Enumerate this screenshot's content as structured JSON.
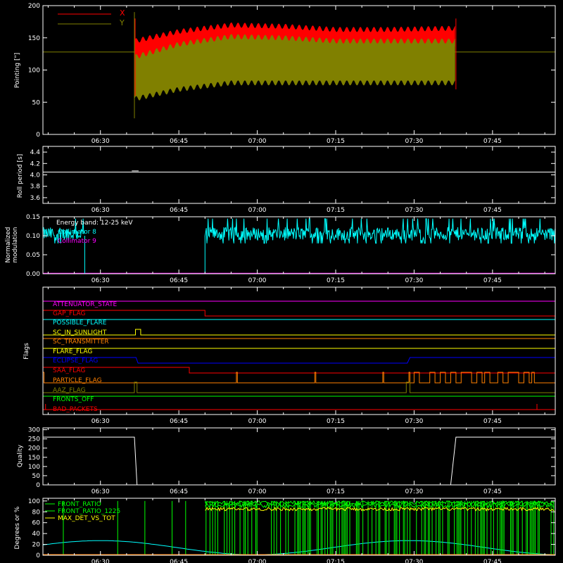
{
  "x_axis": {
    "ticks": [
      "06:30",
      "06:45",
      "07:00",
      "07:15",
      "07:30",
      "07:45"
    ]
  },
  "colors": {
    "background": "#000000",
    "axis": "#ffffff",
    "red": "#ff0000",
    "olive": "#808000",
    "cyan": "#00ffff",
    "magenta": "#ff00ff",
    "green": "#00ff00",
    "yellow": "#ffff00",
    "orange": "#ff8000",
    "blue": "#0000ff"
  },
  "panels": {
    "pointing": {
      "ylabel": "Pointing [\"]",
      "yticks": [
        "0",
        "50",
        "100",
        "150",
        "200"
      ],
      "legend": [
        "X",
        "Y"
      ]
    },
    "roll": {
      "ylabel": "Roll period [s]",
      "yticks": [
        "3.6",
        "3.8",
        "4.0",
        "4.2",
        "4.4"
      ]
    },
    "modulation": {
      "ylabel1": "Normalized",
      "ylabel2": "modulation",
      "yticks": [
        "0.00",
        "0.05",
        "0.10",
        "0.15"
      ],
      "energy_band": "Energy band: 12-25 keV",
      "legend": [
        "Collimator 8",
        "Collimator 9"
      ]
    },
    "flags": {
      "ylabel": "Flags",
      "items": [
        {
          "label": "ATTENUATOR_STATE",
          "color": "#ff00ff"
        },
        {
          "label": "GAP_FLAG",
          "color": "#ff0000"
        },
        {
          "label": "POSSIBLE_FLARE",
          "color": "#00ffff"
        },
        {
          "label": "SC_IN_SUNLIGHT",
          "color": "#ffff00"
        },
        {
          "label": "SC_TRANSMITTER",
          "color": "#ff8000"
        },
        {
          "label": "FLARE_FLAG",
          "color": "#ffff00"
        },
        {
          "label": "ECLIPSE_FLAG",
          "color": "#0000ff"
        },
        {
          "label": "SAA_FLAG",
          "color": "#ff0000"
        },
        {
          "label": "PARTICLE_FLAG",
          "color": "#ff8000"
        },
        {
          "label": "AAZ_FLAG",
          "color": "#808000"
        },
        {
          "label": "FRONTS_OFF",
          "color": "#00ff00"
        },
        {
          "label": "BAD_PACKETS",
          "color": "#ff0000"
        }
      ]
    },
    "quality": {
      "ylabel": "Quality",
      "yticks": [
        "0",
        "50",
        "100",
        "150",
        "200",
        "250",
        "300"
      ]
    },
    "degrees": {
      "ylabel": "Degrees or %",
      "yticks": [
        "0",
        "20",
        "40",
        "60",
        "80",
        "100"
      ],
      "legend": [
        "FRONT_RATIO",
        "FRONT_RATIO_1225",
        "MAX_DET_VS_TOT"
      ]
    }
  },
  "chart_data": [
    {
      "type": "line",
      "x_range": [
        "06:19",
        "07:57"
      ],
      "ylim": [
        0,
        200
      ],
      "series": [
        {
          "name": "X",
          "x": [
            "06:36:30",
            "06:45",
            "06:55",
            "07:05",
            "07:15",
            "07:25",
            "07:38"
          ],
          "upper": [
            145,
            160,
            170,
            168,
            163,
            163,
            165
          ],
          "lower": [
            110,
            125,
            135,
            133,
            132,
            132,
            133
          ]
        },
        {
          "name": "Y",
          "x": [
            "06:36:30",
            "06:45",
            "06:55",
            "07:05",
            "07:15",
            "07:25",
            "07:38"
          ],
          "upper": [
            120,
            140,
            152,
            150,
            145,
            145,
            145
          ],
          "lower": [
            55,
            70,
            80,
            80,
            80,
            80,
            80
          ]
        }
      ]
    },
    {
      "type": "line",
      "ylim": [
        3.5,
        4.5
      ],
      "series": [
        {
          "x": [
            "06:19",
            "06:36",
            "06:37",
            "07:57"
          ],
          "values": [
            4.05,
            4.05,
            4.07,
            4.05
          ]
        }
      ]
    },
    {
      "type": "line",
      "ylim": [
        0,
        0.15
      ],
      "series": [
        {
          "name": "Collimator 8",
          "segments": [
            {
              "x": [
                "06:19",
                "06:27"
              ],
              "mean": 0.105
            },
            {
              "x": [
                "06:50",
                "07:57"
              ],
              "mean": 0.105
            }
          ]
        },
        {
          "name": "Collimator 9",
          "x": [
            "06:19",
            "07:57"
          ],
          "values": [
            0.0,
            0.0
          ]
        }
      ]
    },
    {
      "type": "line",
      "ylim": [
        0,
        300
      ],
      "series": [
        {
          "x": [
            "06:19",
            "06:36:30",
            "06:37",
            "07:37",
            "07:38",
            "07:57"
          ],
          "values": [
            260,
            260,
            0,
            0,
            260,
            260
          ]
        }
      ]
    },
    {
      "type": "line",
      "ylim": [
        0,
        100
      ],
      "series": [
        {
          "name": "FRONT_RATIO",
          "active_from": "06:50",
          "values": [
            100
          ]
        },
        {
          "name": "FRONT_RATIO_1225",
          "active_from": "06:50",
          "values": [
            95
          ]
        },
        {
          "name": "MAX_DET_VS_TOT",
          "active_from": "06:50",
          "values": [
            85
          ]
        }
      ]
    }
  ]
}
